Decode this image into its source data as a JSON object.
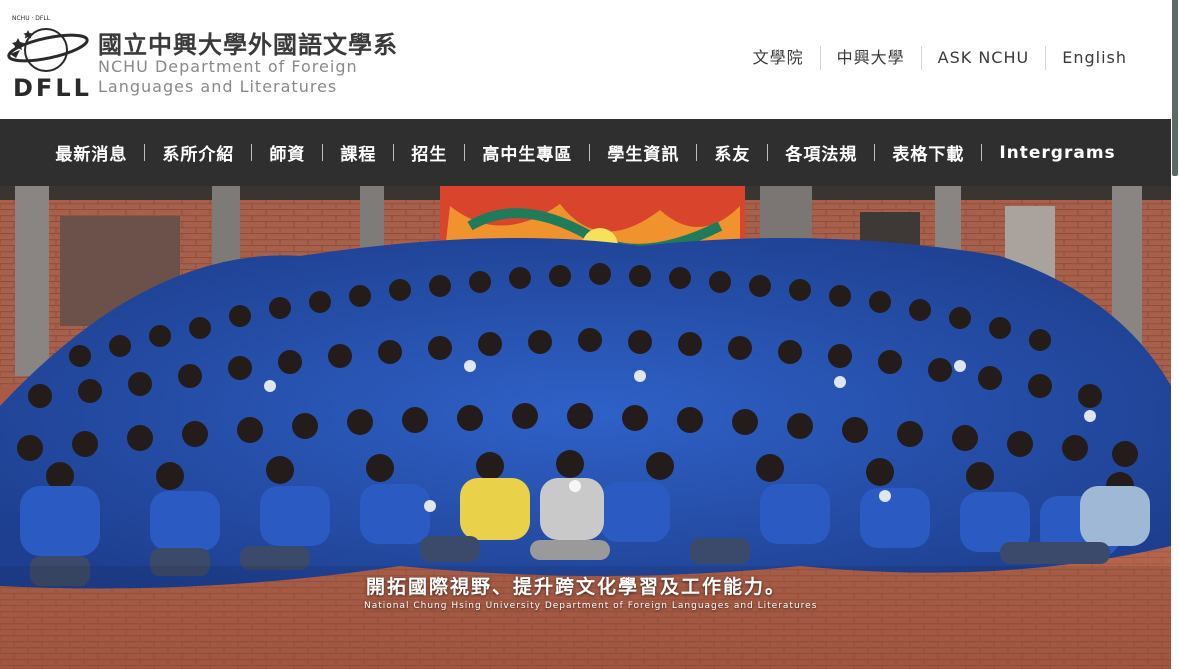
{
  "header": {
    "logo_text": "DFLL",
    "logo_ring_text": "NCHU · DFLL",
    "title_zh": "國立中興大學外國語文學系",
    "title_en_line1": "NCHU Department of Foreign",
    "title_en_line2": "Languages and Literatures",
    "links": [
      "文學院",
      "中興大學",
      "ASK NCHU",
      "English"
    ]
  },
  "nav": {
    "items": [
      "最新消息",
      "系所介紹",
      "師資",
      "課程",
      "招生",
      "高中生專區",
      "學生資訊",
      "系友",
      "各項法規",
      "表格下載",
      "Intergrams"
    ]
  },
  "hero": {
    "caption": "開拓國際視野、提升跨文化學習及工作能力。",
    "subcaption": "National Chung Hsing University Department of Foreign Languages and Literatures"
  },
  "colors": {
    "nav_bg": "#2f2f2f",
    "shirt_blue": "#2a5bc4",
    "brick": "#b0604a"
  }
}
